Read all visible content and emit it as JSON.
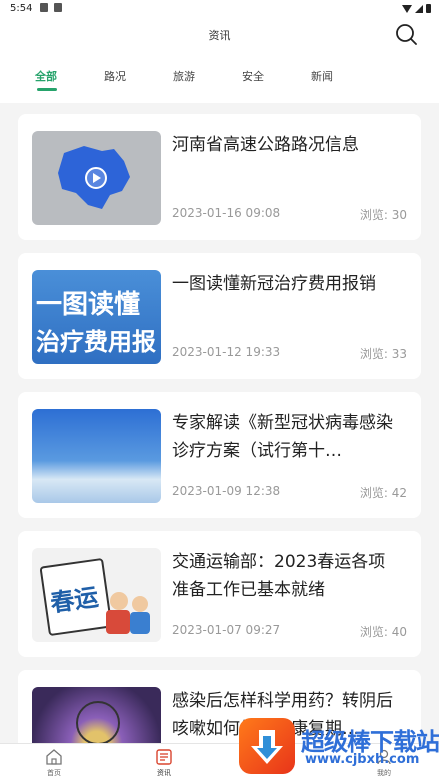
{
  "status_bar": {
    "time": "5:54"
  },
  "header": {
    "title": "资讯"
  },
  "tabs": [
    {
      "label": "全部",
      "active": true
    },
    {
      "label": "路况",
      "active": false
    },
    {
      "label": "旅游",
      "active": false
    },
    {
      "label": "安全",
      "active": false
    },
    {
      "label": "新闻",
      "active": false
    }
  ],
  "articles": [
    {
      "title": "河南省高速公路路况信息",
      "date": "2023-01-16 09:08",
      "views": "浏览: 30"
    },
    {
      "title": "一图读懂新冠治疗费用报销",
      "date": "2023-01-12 19:33",
      "views": "浏览: 33",
      "thumb_text": [
        "一图读懂",
        "治疗费用报"
      ]
    },
    {
      "title": "专家解读《新型冠状病毒感染诊疗方案（试行第十…",
      "date": "2023-01-09 12:38",
      "views": "浏览: 42"
    },
    {
      "title": "交通运输部：2023春运各项准备工作已基本就绪",
      "date": "2023-01-07 09:27",
      "views": "浏览: 40",
      "thumb_text": [
        "春运"
      ]
    },
    {
      "title": "感染后怎样科学用药？转阴后咳嗽如何缓解？康复期…",
      "date": "",
      "views": ""
    }
  ],
  "bottom_nav": [
    {
      "label": "首页",
      "icon": "home-icon"
    },
    {
      "label": "资讯",
      "icon": "news-icon",
      "active": true
    },
    {
      "label": "我的",
      "icon": "profile-icon"
    }
  ],
  "watermark": {
    "text": "超级棒下载站",
    "url": "www.cjbxh.com"
  },
  "colors": {
    "accent": "#26a36b",
    "watermark": "#2f6fd8"
  }
}
